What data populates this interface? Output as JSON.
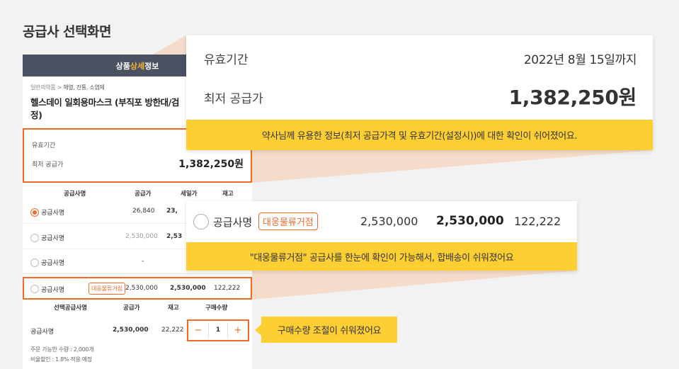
{
  "page": {
    "title": "공급사 선택화면"
  },
  "phone": {
    "header_part1": "상품",
    "header_accent": "상세",
    "header_part2": "정보",
    "breadcrumb_prefix": "일반의약품 > ",
    "breadcrumb_tail": "해열, 진통, 소염제",
    "product_name_line1": "헬스데이 일회용마스크 (부직포 방한대/검",
    "product_name_line2": "정)",
    "info": {
      "expiry_label": "유효기간",
      "lowest_label": "최저 공급가",
      "lowest_price": "1,382,250원"
    },
    "table_headers": [
      "공급사명",
      "공급가",
      "세일가",
      "재고"
    ],
    "rows": [
      {
        "name": "공급사명",
        "price": "26,840",
        "sale": "23,",
        "selected": true
      },
      {
        "name": "공급사명",
        "price": "2,530,000",
        "sale": "2,53",
        "selected": false
      },
      {
        "name": "공급사명",
        "price": "-",
        "sale": "",
        "selected": false
      }
    ],
    "highlight_row": {
      "name": "공급사명",
      "tag": "대웅물류거점",
      "price": "2,530,000",
      "sale": "2,530,000",
      "stock": "122,222"
    },
    "selected_headers": [
      "선택공급사명",
      "공급가",
      "재고",
      "구매수량"
    ],
    "selected_row": {
      "name": "공급사명",
      "price": "2,530,000",
      "stock": "22,222",
      "qty": "1",
      "minus": "−",
      "plus": "+"
    },
    "note_qty": "주문 가능한 수량 : 2,000개",
    "note_discount": "비율할인 : 1.8% 적용 예정"
  },
  "zoom1": {
    "expiry_label": "유효기간",
    "expiry_value": "2022년 8월 15일까지",
    "lowest_label": "최저 공급가",
    "lowest_value": "1,382,250원",
    "banner": "약사님께 유용한 정보(최저 공급가격 및 유효기간(설정시))에 대한 확인이 쉬어졌어요."
  },
  "zoom2": {
    "name": "공급사명",
    "tag": "대웅물류거점",
    "price": "2,530,000",
    "sale": "2,530,000",
    "stock": "122,222",
    "banner": "\"대웅물류거점\" 공급사를 한눈에 확인이 가능해서, 합배송이 쉬워졌어요"
  },
  "callout3": {
    "text": "구매수량 조절이 쉬워졌어요"
  },
  "colors": {
    "accent": "#f26b2b",
    "highlight": "#fecf33",
    "header_bg": "#4a5160"
  }
}
